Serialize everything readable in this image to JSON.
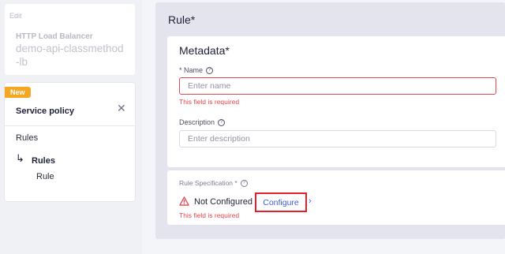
{
  "sidebar": {
    "edit_label": "Edit",
    "object_type": "HTTP Load Balancer",
    "object_name": "demo-api-classmethod-lb",
    "badge": "New",
    "policy_title": "Service policy",
    "close_icon": "close-icon",
    "nav": {
      "rules": "Rules",
      "rules_active": "Rules",
      "rule": "Rule"
    }
  },
  "main": {
    "title": "Rule*",
    "metadata": {
      "title": "Metadata*",
      "name_label": "* Name",
      "name_placeholder": "Enter name",
      "name_error": "This field is required",
      "description_label": "Description",
      "description_placeholder": "Enter description"
    },
    "rule_spec": {
      "label": "Rule Specification *",
      "status": "Not Configured",
      "configure": "Configure",
      "error": "This field is required"
    }
  },
  "colors": {
    "error": "#e5484d",
    "link": "#3d5fd9",
    "badge": "#f5a623",
    "highlight": "#e4212b"
  }
}
